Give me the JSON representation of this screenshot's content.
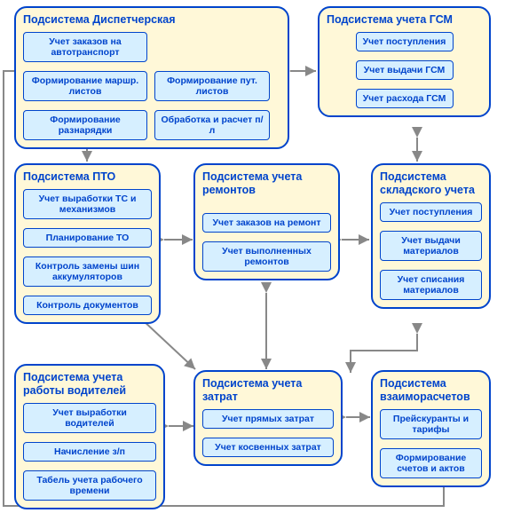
{
  "subsystems": {
    "dispatch": {
      "title": "Подсистема Диспетчерская",
      "b1": "Учет заказов на автотранспорт",
      "b2": "Формирование маршр. листов",
      "b3": "Формирование разнарядки",
      "b4": "Формирование пут. листов",
      "b5": "Обработка и расчет п/л"
    },
    "gsm": {
      "title": "Подсистема учета ГСМ",
      "b1": "Учет поступления",
      "b2": "Учет выдачи ГСМ",
      "b3": "Учет расхода ГСМ"
    },
    "pto": {
      "title": "Подсистема ПТО",
      "b1": "Учет выработки ТС и механизмов",
      "b2": "Планирование ТО",
      "b3": "Контроль замены шин аккумуляторов",
      "b4": "Контроль документов"
    },
    "repairs": {
      "title": "Подсистема учета ремонтов",
      "b1": "Учет заказов на ремонт",
      "b2": "Учет выполненных ремонтов"
    },
    "warehouse": {
      "title": "Подсистема складского учета",
      "b1": "Учет поступления",
      "b2": "Учет выдачи материалов",
      "b3": "Учет списания материалов"
    },
    "drivers": {
      "title": "Подсистема учета работы водителей",
      "b1": "Учет выработки водителей",
      "b2": "Начисление з/п",
      "b3": "Табель учета рабочего времени"
    },
    "costs": {
      "title": "Подсистема учета затрат",
      "b1": "Учет прямых затрат",
      "b2": "Учет косвенных затрат"
    },
    "settlements": {
      "title": "Подсистема взаиморасчетов",
      "b1": "Прейскуранты и тарифы",
      "b2": "Формирование счетов и актов"
    }
  }
}
